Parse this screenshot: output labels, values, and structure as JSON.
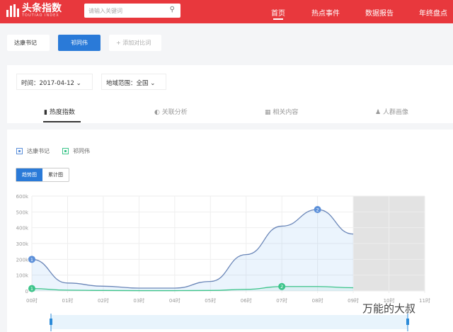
{
  "header": {
    "logo_title": "头条指数",
    "logo_sub": "TOUTIAO INDEX",
    "search_placeholder": "请输入关键词",
    "nav": [
      "首页",
      "热点事件",
      "数据报告",
      "年终盘点"
    ]
  },
  "keywords": {
    "items": [
      "达康书记",
      "祁同伟"
    ],
    "add_label": "+ 添加对比词"
  },
  "filters": {
    "time": "时间：2017-04-12",
    "region": "地域范围：全国"
  },
  "tabs": [
    "热度指数",
    "关联分析",
    "相关内容",
    "人群画像"
  ],
  "legend": [
    "达康书记",
    "祁同伟"
  ],
  "view_toggle": [
    "趋势图",
    "累计图"
  ],
  "watermark": "万能的大叔",
  "colors": {
    "brand": "#e8383d",
    "blue": "#5b8fd9",
    "green": "#3cc48a"
  },
  "chart_data": {
    "type": "area",
    "x": [
      "00时",
      "01时",
      "02时",
      "03时",
      "04时",
      "05时",
      "06时",
      "07时",
      "08时",
      "09时",
      "10时",
      "11时"
    ],
    "yticks": [
      "0",
      "100k",
      "200k",
      "300k",
      "400k",
      "500k",
      "600k"
    ],
    "ylim": [
      0,
      600000
    ],
    "series": [
      {
        "name": "达康书记",
        "values": [
          200000,
          50000,
          30000,
          18000,
          18000,
          60000,
          230000,
          410000,
          515000,
          360000
        ],
        "markers": [
          {
            "index": 0,
            "label": "1"
          },
          {
            "index": 8,
            "label": "2"
          }
        ]
      },
      {
        "name": "祁同伟",
        "values": [
          15000,
          5000,
          3000,
          2000,
          2000,
          3000,
          10000,
          28000,
          28000,
          20000
        ],
        "markers": [
          {
            "index": 0,
            "label": "1"
          },
          {
            "index": 7,
            "label": "2"
          }
        ]
      }
    ],
    "future_range": [
      "09时",
      "11时"
    ]
  }
}
